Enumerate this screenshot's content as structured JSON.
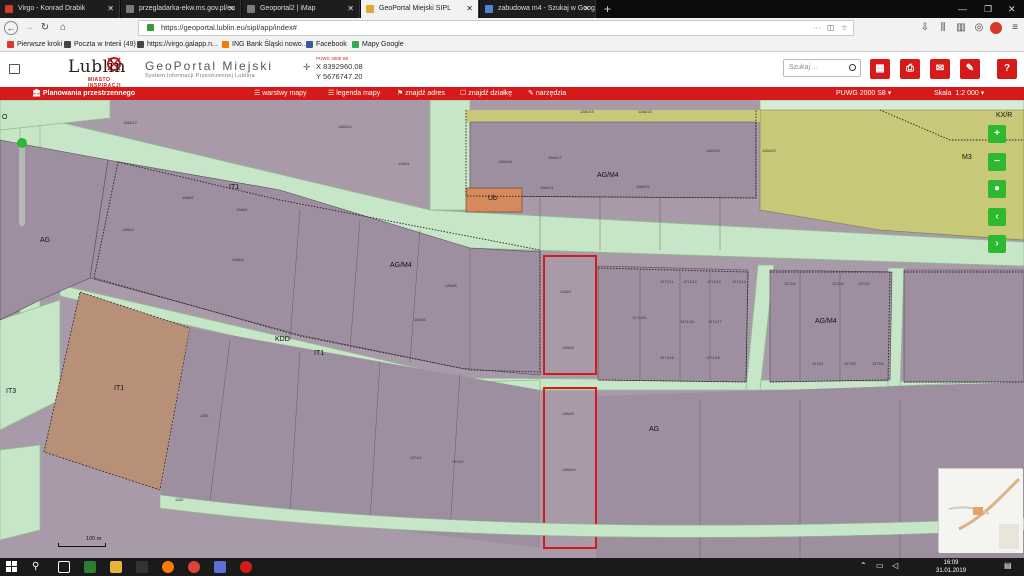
{
  "browser": {
    "tabs": [
      {
        "title": "Virgo - Konrad Drabik",
        "color": "#d9372b"
      },
      {
        "title": "przegladarka-ekw.ms.gov.pl/eu",
        "color": "#7a7a7a"
      },
      {
        "title": "Geoportal2 | iMap",
        "color": "#7a7a7a"
      },
      {
        "title": "GeoPortal Miejski SIPL",
        "color": "#e0a82e"
      },
      {
        "title": "zabudowa m4 - Szukaj w Goog",
        "color": "#4a86d8"
      }
    ],
    "new_tab": "+",
    "url": "https://geoportal.lublin.eu/sipl/app/index#",
    "url_more": "···",
    "bookmarks": [
      {
        "label": "Pierwsze kroki",
        "color": "#d9372b"
      },
      {
        "label": "Poczta w Interii (49)",
        "color": "#444444"
      },
      {
        "label": "https://virgo.galapp.n...",
        "color": "#444444"
      },
      {
        "label": "ING Bank Śląski nowo...",
        "color": "#f07c00"
      },
      {
        "label": "Facebook",
        "color": "#3b5998"
      },
      {
        "label": "Mapy Google",
        "color": "#34a853"
      }
    ]
  },
  "app": {
    "logo_text": "Lublin",
    "logo_sub": "MIASTO INSPIRACJI",
    "title": "GeoPortal Miejski",
    "subtitle": "System Informacji Przestrzennej Lublina",
    "coord_system": "PUWG 2000 S8",
    "coord_x": "X 8392960.08",
    "coord_y": "Y 5676747.20",
    "search_placeholder": "Szukaj ...",
    "header_icons": [
      "grid-icon",
      "print-icon",
      "mail-icon",
      "edit-icon",
      "help-icon"
    ],
    "help_label": "?"
  },
  "toolbar": {
    "section": "Planowania przestrzennego",
    "layers": "warstwy mapy",
    "legend": "legenda mapy",
    "find_address": "znajdź adres",
    "find_plot": "znajdź działkę",
    "tools": "narzędzia",
    "crs": "PUWG 2000 S8",
    "scale_label": "Skala",
    "scale_value": "1:2 000"
  },
  "map": {
    "zones": {
      "ag_m4_top": "AG/M4",
      "ag_m4_mid": "AG/M4",
      "ag_left": "AG",
      "ag_bottom": "AG",
      "ub": "Ub",
      "kdd": "KDD",
      "it1_a": "IT1",
      "it1_b": "IT1",
      "it1_c": "IT1",
      "it3": "IT3",
      "kx_r": "KX/R",
      "m3": "M3",
      "o": "O",
      "ag_m4_right": "AG/M4"
    },
    "parcel_labels": [
      "1266/12",
      "1266/14",
      "1266/15",
      "1266/16",
      "1266/17",
      "1266/18",
      "1266/19",
      "1266/20",
      "1266/21",
      "1266/22",
      "1246/1",
      "1266/1",
      "1266/2",
      "1266/3",
      "1266/4",
      "1266/5",
      "1266/6",
      "1266/7",
      "1266/8",
      "1266/9",
      "1266/10",
      "1271/11",
      "1271/12",
      "1271/13",
      "1271/14",
      "1271/15",
      "1271/16",
      "1271/17",
      "1271/18",
      "1271/19",
      "1272/2",
      "1272/3",
      "1272/4",
      "1273/1",
      "1273/2",
      "1273/3",
      "1274/1",
      "1274/2",
      "1281",
      "1282"
    ],
    "scale_bar": "100 m"
  },
  "map_controls": {
    "zoom_in": "+",
    "zoom_out": "−",
    "locate": "●",
    "back": "‹",
    "forward": "›"
  },
  "taskbar": {
    "time": "16:09",
    "date": "31.01.2019"
  }
}
